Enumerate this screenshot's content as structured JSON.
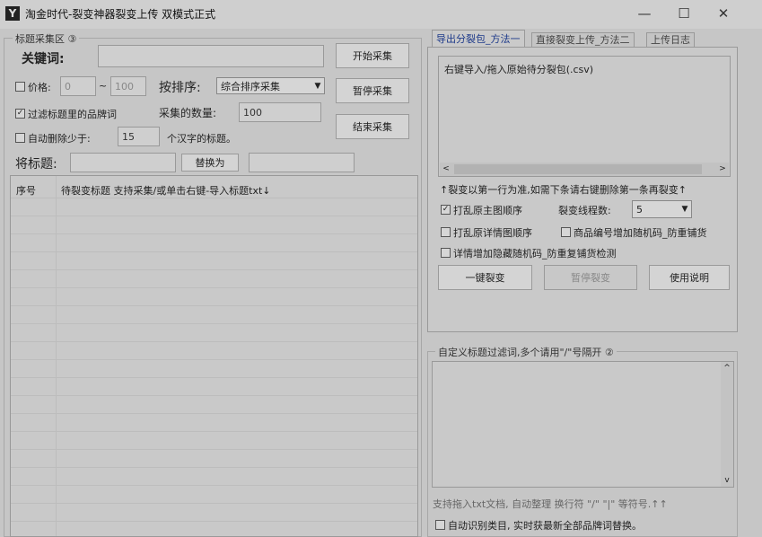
{
  "window": {
    "title": "淘金时代-裂变神器裂变上传 双模式正式",
    "minimize_glyph": "—",
    "maximize_glyph": "☐",
    "close_glyph": "✕"
  },
  "left": {
    "group_label": "标题采集区 ③",
    "keyword_label": "关键词:",
    "keyword_value": "",
    "price_label": "价格:",
    "price_min": "0",
    "price_tilde": "~",
    "price_max": "100",
    "sort_label": "按排序:",
    "sort_value": "综合排序采集",
    "filter_brand_label": "过滤标题里的品牌词",
    "quantity_label": "采集的数量:",
    "quantity_value": "100",
    "auto_delete_label": "自动删除少于:",
    "auto_delete_value": "15",
    "auto_delete_suffix": "个汉字的标题。",
    "replace_label": "将标题:",
    "replace_from": "",
    "replace_button": "替换为",
    "replace_to": "",
    "buttons": {
      "start": "开始采集",
      "pause": "暂停采集",
      "stop": "结束采集"
    },
    "table_headers": [
      "序号",
      "待裂变标题 支持采集/或单击右键-导入标题txt↓"
    ]
  },
  "right": {
    "tabs": [
      "导出分裂包_方法一",
      "直接裂变上传_方法二",
      "上传日志"
    ],
    "list_item": "右键导入/拖入原始待分裂包(.csv)",
    "hint": "↑裂变以第一行为准,如需下条请右键删除第一条再裂变↑",
    "shuffle_main": "打乱原主图顺序",
    "thread_label": "裂变线程数:",
    "thread_value": "5",
    "shuffle_detail": "打乱原详情图顺序",
    "add_code": "商品编号增加随机码_防重铺货",
    "detail_code": "详情增加隐藏随机码_防重复铺货检测",
    "buttons": {
      "split": "一键裂变",
      "pause": "暂停裂变",
      "help": "使用说明"
    },
    "filter_group_label": "自定义标题过滤词,多个请用\"/\"号隔开 ②",
    "filter_hint": "支持拖入txt文档, 自动整理 换行符 \"/\" \"|\" 等符号.↑↑",
    "auto_identify": "自动识别类目, 实时获最新全部品牌词替换。"
  },
  "checkmark": "✓"
}
